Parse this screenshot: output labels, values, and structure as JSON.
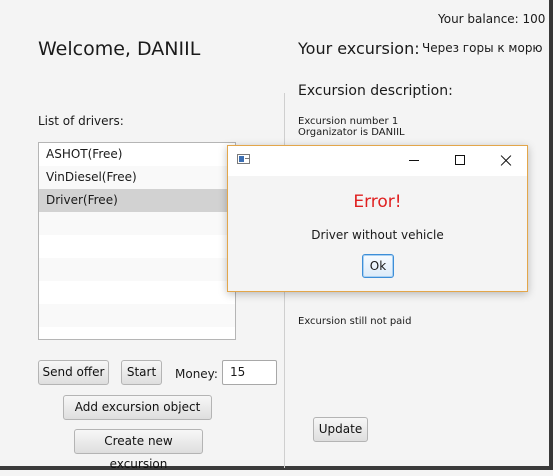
{
  "header": {
    "balance": "Your balance: 100",
    "welcome": "Welcome, DANIIL",
    "excursion_label": "Your excursion:",
    "excursion_name": "Через горы к морю"
  },
  "description": {
    "title": "Excursion description:",
    "lines": [
      "Excursion number 1",
      "Organizator is DANIIL"
    ],
    "payment_status": "Excursion still not paid"
  },
  "drivers": {
    "label": "List of drivers:",
    "items": [
      "ASHOT(Free)",
      "VinDiesel(Free)",
      "Driver(Free)"
    ],
    "selected": "Driver(Free)"
  },
  "controls": {
    "send_offer": "Send offer",
    "start": "Start",
    "money_label": "Money:",
    "money_value": "15",
    "add_object": "Add excursion object",
    "create_new": "Create new excursion",
    "update": "Update"
  },
  "dialog": {
    "title": "Error!",
    "message": "Driver without vehicle",
    "ok": "Ok",
    "icons": [
      "app-icon",
      "minimize-icon",
      "maximize-icon",
      "close-icon"
    ]
  },
  "colors": {
    "error": "#e02020",
    "dialog_border": "#e3a64a",
    "selection": "#d2d2d2",
    "focus_blue": "#3c8ed8"
  }
}
